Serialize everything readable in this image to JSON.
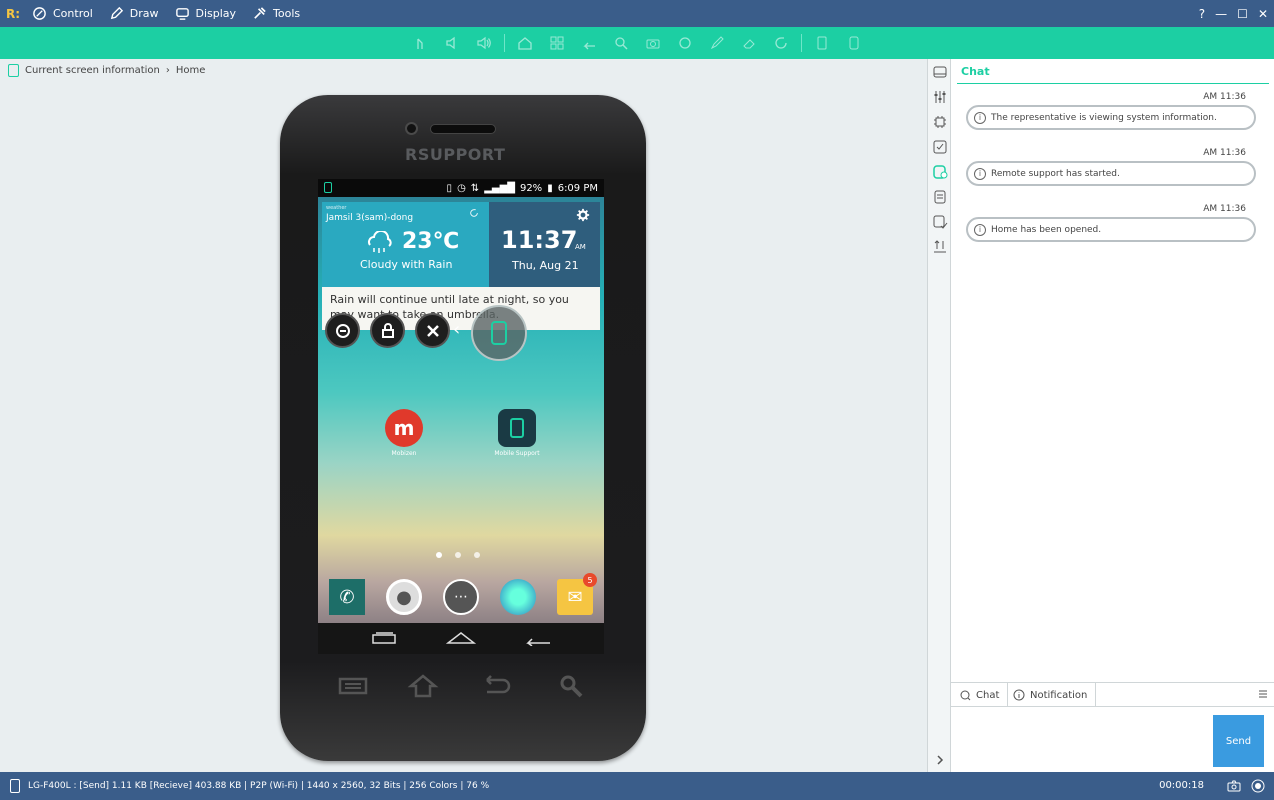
{
  "app": {
    "logo": "R:",
    "menu": [
      {
        "label": "Control",
        "icon": "pen-circle-icon"
      },
      {
        "label": "Draw",
        "icon": "pencil-icon"
      },
      {
        "label": "Display",
        "icon": "monitor-icon"
      },
      {
        "label": "Tools",
        "icon": "tools-icon"
      }
    ],
    "window_controls": [
      "?",
      "—",
      "☐",
      "✕"
    ]
  },
  "breadcrumb": {
    "root": "Current screen information",
    "separator": "›",
    "current": "Home"
  },
  "device": {
    "brand": "RSUPPORT",
    "status": {
      "battery": "92%",
      "time": "6:09 PM"
    },
    "weather": {
      "source": "weather",
      "location": "Jamsil 3(sam)-dong",
      "temp": "23℃",
      "condition": "Cloudy with Rain"
    },
    "clock": {
      "time": "11:37",
      "ampm": "AM",
      "date": "Thu, Aug 21"
    },
    "notice": "Rain will continue until late at night, so you may want to take an umbrella.",
    "apps": [
      {
        "name": "Mobizen",
        "color": "#e0392b"
      },
      {
        "name": "Mobile Support",
        "color": "#1a3a44"
      }
    ],
    "page_dots": 3,
    "dock_badge": "5"
  },
  "chat": {
    "title": "Chat",
    "messages": [
      {
        "time": "AM 11:36",
        "text": "The representative is viewing system information."
      },
      {
        "time": "AM 11:36",
        "text": "Remote support has started."
      },
      {
        "time": "AM 11:36",
        "text": "Home has been opened."
      }
    ],
    "tabs": [
      "Chat",
      "Notification"
    ],
    "send_label": "Send"
  },
  "footer": {
    "info": "LG-F400L : [Send] 1.11 KB  [Recieve] 403.88 KB | P2P (Wi-Fi) | 1440 x 2560, 32 Bits | 256 Colors | 76 %",
    "timer": "00:00:18"
  },
  "colors": {
    "titlebar": "#3a5d8a",
    "accent": "#1ccfa3",
    "send": "#3a9be0"
  }
}
